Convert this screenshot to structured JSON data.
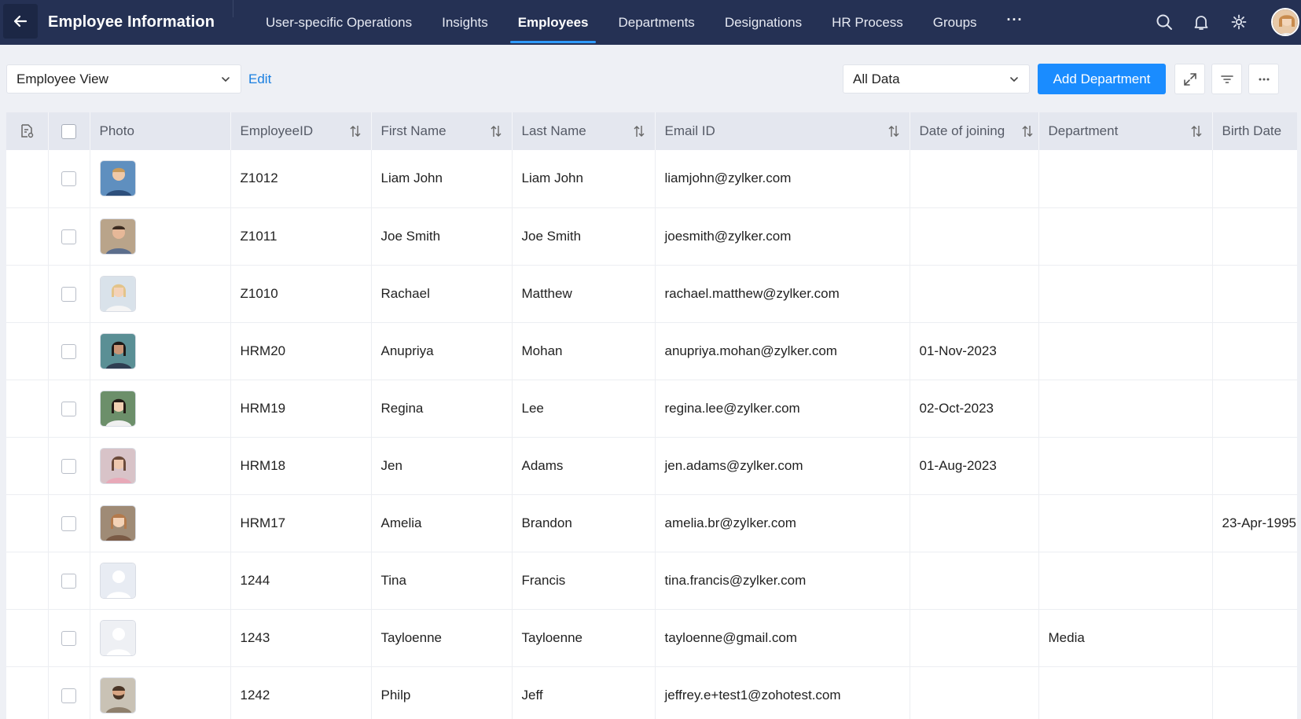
{
  "header": {
    "title": "Employee Information",
    "nav": [
      {
        "label": "User-specific Operations",
        "active": false
      },
      {
        "label": "Insights",
        "active": false
      },
      {
        "label": "Employees",
        "active": true
      },
      {
        "label": "Departments",
        "active": false
      },
      {
        "label": "Designations",
        "active": false
      },
      {
        "label": "HR Process",
        "active": false
      },
      {
        "label": "Groups",
        "active": false
      }
    ],
    "more_label": "···",
    "icons": [
      "search-icon",
      "bell-icon",
      "gear-icon"
    ]
  },
  "toolbar": {
    "view_selected": "Employee View",
    "edit_label": "Edit",
    "data_filter_selected": "All Data",
    "add_department_label": "Add Department",
    "icons": [
      "expand-icon",
      "filter-icon",
      "more-icon"
    ]
  },
  "table": {
    "columns": [
      "Photo",
      "EmployeeID",
      "First Name",
      "Last Name",
      "Email ID",
      "Date of joining",
      "Department",
      "Birth Date"
    ],
    "rows": [
      {
        "id": "Z1012",
        "first": "Liam John",
        "last": "Liam John",
        "email": "liamjohn@zylker.com",
        "doj": "",
        "dept": "",
        "birth": "",
        "photo": "blue"
      },
      {
        "id": "Z1011",
        "first": "Joe Smith",
        "last": "Joe Smith",
        "email": "joesmith@zylker.com",
        "doj": "",
        "dept": "",
        "birth": "",
        "photo": "tan"
      },
      {
        "id": "Z1010",
        "first": "Rachael",
        "last": "Matthew",
        "email": "rachael.matthew@zylker.com",
        "doj": "",
        "dept": "",
        "birth": "",
        "photo": "light"
      },
      {
        "id": "HRM20",
        "first": "Anupriya",
        "last": "Mohan",
        "email": "anupriya.mohan@zylker.com",
        "doj": "01-Nov-2023",
        "dept": "",
        "birth": "",
        "photo": "teal"
      },
      {
        "id": "HRM19",
        "first": "Regina",
        "last": "Lee",
        "email": "regina.lee@zylker.com",
        "doj": "02-Oct-2023",
        "dept": "",
        "birth": "",
        "photo": "green"
      },
      {
        "id": "HRM18",
        "first": "Jen",
        "last": "Adams",
        "email": "jen.adams@zylker.com",
        "doj": "01-Aug-2023",
        "dept": "",
        "birth": "",
        "photo": "pink"
      },
      {
        "id": "HRM17",
        "first": "Amelia",
        "last": "Brandon",
        "email": "amelia.br@zylker.com",
        "doj": "",
        "dept": "",
        "birth": "23-Apr-1995",
        "photo": "brown"
      },
      {
        "id": "1244",
        "first": "Tina",
        "last": "Francis",
        "email": "tina.francis@zylker.com",
        "doj": "",
        "dept": "",
        "birth": "",
        "photo": "placeholder"
      },
      {
        "id": "1243",
        "first": "Tayloenne",
        "last": "Tayloenne",
        "email": "tayloenne@gmail.com",
        "doj": "",
        "dept": "Media",
        "birth": "",
        "photo": "inactive"
      },
      {
        "id": "1242",
        "first": "Philp",
        "last": "Jeff",
        "email": "jeffrey.e+test1@zohotest.com",
        "doj": "",
        "dept": "",
        "birth": "",
        "photo": "beard"
      }
    ]
  }
}
